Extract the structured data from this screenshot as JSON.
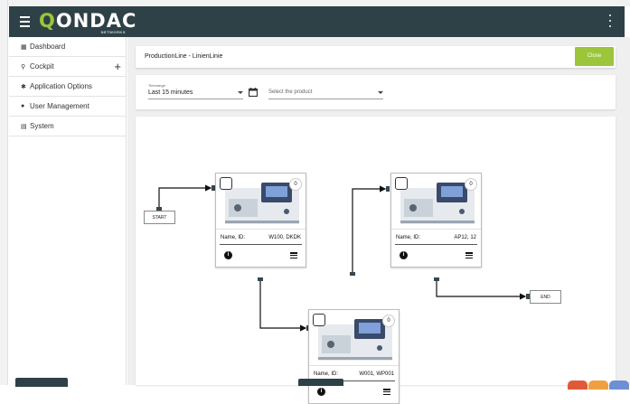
{
  "app": {
    "logo_text_main": "QONDAC",
    "logo_text_sub": "NETWORKS",
    "accent_color": "#9cc53a",
    "header_color": "#2e4147"
  },
  "sidebar": {
    "items": [
      {
        "label": "Dashboard",
        "icon": "dashboard-icon"
      },
      {
        "label": "Cockpit",
        "icon": "search-icon"
      },
      {
        "label": "Application Options",
        "icon": "gear-icon"
      },
      {
        "label": "User Management",
        "icon": "user-icon"
      },
      {
        "label": "System",
        "icon": "system-icon"
      }
    ]
  },
  "panel": {
    "title": "ProductionLine - LinienLinie",
    "close_label": "Close"
  },
  "filters": {
    "timerange_label": "Timerange",
    "timerange_value": "Last 15 minutes",
    "product_placeholder": "Select the product"
  },
  "flow": {
    "start_label": "START",
    "end_label": "END",
    "nodes": [
      {
        "name_label": "Name, ID:",
        "name_value": "W100, DKDK",
        "count": "0"
      },
      {
        "name_label": "Name, ID:",
        "name_value": "AP12, 12",
        "count": "0"
      },
      {
        "name_label": "Name, ID:",
        "name_value": "W001, WP001",
        "count": "0"
      }
    ]
  },
  "status": {
    "colors": [
      "#e05a3a",
      "#f0a040",
      "#6e8fd4"
    ]
  }
}
